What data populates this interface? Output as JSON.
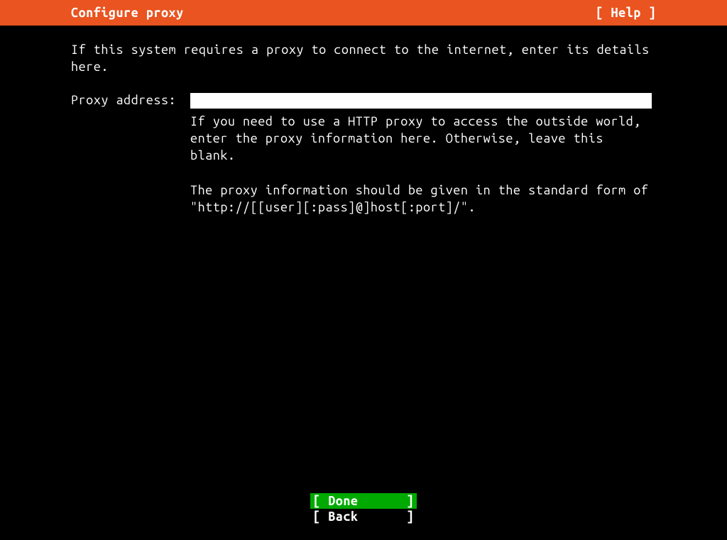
{
  "header": {
    "title": "Configure proxy",
    "help_label": "[ Help ]"
  },
  "intro_text": "If this system requires a proxy to connect to the internet, enter its details\nhere.",
  "field": {
    "label": "Proxy address:",
    "value": "",
    "help_text": "If you need to use a HTTP proxy to access the outside world,\nenter the proxy information here. Otherwise, leave this blank.\n\nThe proxy information should be given in the standard form of\n\"http://[[user][:pass]@]host[:port]/\"."
  },
  "buttons": {
    "done_open": "[",
    "done_text": "Done",
    "done_close": "]",
    "back_open": "[",
    "back_text": "Back",
    "back_close": "]"
  }
}
